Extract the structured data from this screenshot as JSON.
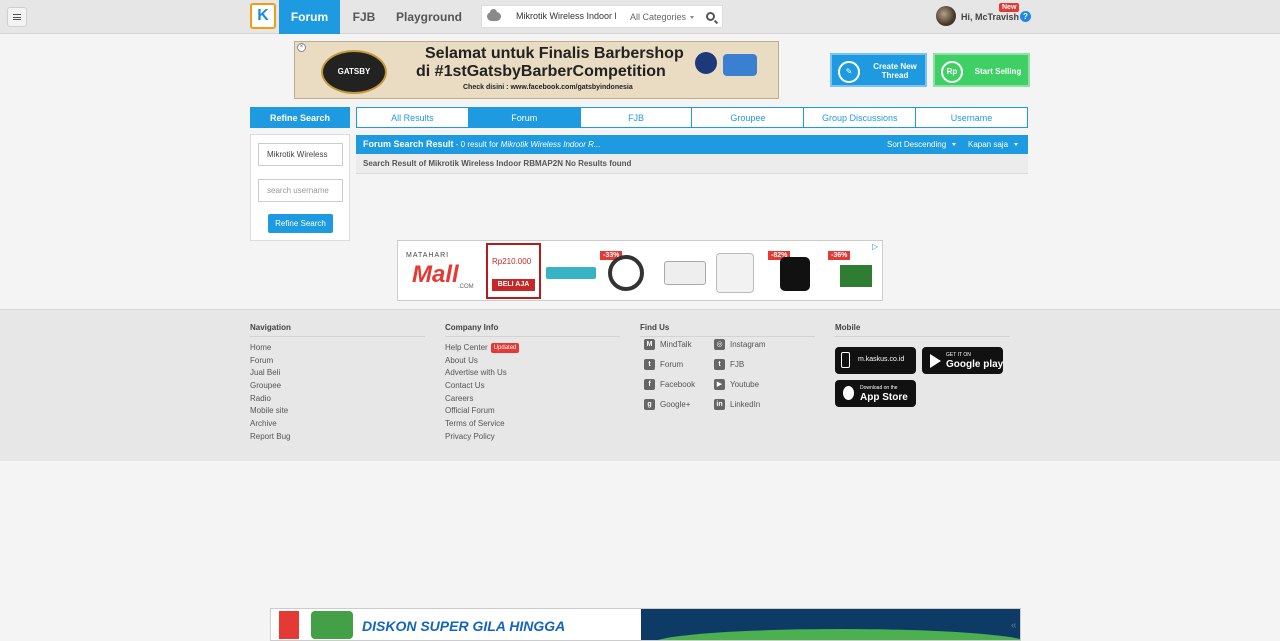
{
  "topnav": {
    "logo": "K",
    "tabs": [
      {
        "label": "Forum",
        "active": true
      },
      {
        "label": "FJB",
        "active": false
      },
      {
        "label": "Playground",
        "active": false
      }
    ],
    "search_value": "Mikrotik Wireless Indoor RE",
    "category": "All Categories",
    "user_greeting": "Hi, McTravish",
    "new_badge": "New",
    "help": "?"
  },
  "banner": {
    "line1": "Selamat untuk Finalis Barbershop",
    "line2": "di #1stGatsbyBarberCompetition",
    "line3": "Check disini : www.facebook.com/gatsbyindonesia",
    "badge": "GATSBY"
  },
  "actions": {
    "create_thread": "Create New Thread",
    "start_selling": "Start Selling",
    "create_icon": "✎",
    "sell_icon": "Rp"
  },
  "refine": {
    "header": "Refine Search",
    "keyword_value": "Mikrotik Wireless",
    "username_placeholder": "search username",
    "button": "Refine Search"
  },
  "result_tabs": [
    {
      "label": "All Results",
      "active": false
    },
    {
      "label": "Forum",
      "active": true
    },
    {
      "label": "FJB",
      "active": false
    },
    {
      "label": "Groupee",
      "active": false
    },
    {
      "label": "Group Discussions",
      "active": false
    },
    {
      "label": "Username",
      "active": false
    }
  ],
  "results": {
    "title": "Forum Search Result",
    "count_text": " - 0 result for ",
    "query": "Mikrotik Wireless Indoor R...",
    "sort": "Sort Descending",
    "time": "Kapan saja",
    "message": "Search Result of Mikrotik Wireless Indoor RBMAP2N No Results found"
  },
  "ad": {
    "brand_top": "MATAHARI",
    "brand": "Mall",
    "brand_suffix": ".COM",
    "price": "Rp210.000",
    "cta": "BELI AJA",
    "discounts": [
      "-33%",
      "-82%",
      "-36%"
    ],
    "info": "▷"
  },
  "footer": {
    "navigation": {
      "title": "Navigation",
      "links": [
        "Home",
        "Forum",
        "Jual Beli",
        "Groupee",
        "Radio",
        "Mobile site",
        "Archive",
        "Report Bug"
      ]
    },
    "company": {
      "title": "Company Info",
      "links": [
        "Help Center",
        "About Us",
        "Advertise with Us",
        "Contact Us",
        "Careers",
        "Official Forum",
        "Terms of Service",
        "Privacy Policy"
      ],
      "updated_badge": "Updated"
    },
    "find_us": {
      "title": "Find Us",
      "left": [
        "MindTalk",
        "Forum",
        "Facebook",
        "Google+"
      ],
      "right": [
        "Instagram",
        "FJB",
        "Youtube",
        "LinkedIn"
      ]
    },
    "mobile": {
      "title": "Mobile",
      "site": "m.kaskus.co.id",
      "gp_small": "GET IT ON",
      "gp_big": "Google play",
      "as_small": "Download on the",
      "as_big": "App Store"
    }
  },
  "bottom_ad": {
    "headline": "DISKON SUPER GILA HINGGA",
    "collapse": "«"
  }
}
